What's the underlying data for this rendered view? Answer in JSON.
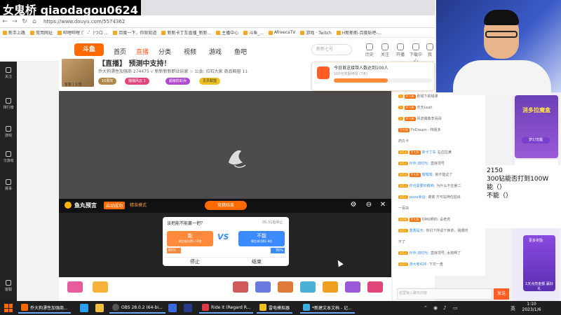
{
  "stream_overlay": {
    "title": "女鬼桥 qiaodagou0624"
  },
  "browser": {
    "url": "https://www.douyu.com/5574362",
    "bookmarks": [
      "新手上路",
      "常用网址",
      "哔哩哔哩 (゜-゜)つロ ...",
      "百度一下，你就知道",
      "新新卡丁车直播_新新...",
      "主播中心",
      "斗鱼_...",
      "AfreecaTV",
      "游戏 · Twitch",
      "H新新新-百度贴吧-..."
    ]
  },
  "site": {
    "logo": "斗鱼",
    "nav": [
      "首页",
      "直播",
      "分类",
      "视频",
      "游戏",
      "鱼吧"
    ],
    "search_placeholder": "新新七号",
    "header_icons": [
      "历史",
      "关注",
      "开播",
      "下载中心",
      "我"
    ]
  },
  "sidebar": {
    "items": [
      "关注",
      "排行榜",
      "游戏",
      "习游戏",
      "赛事",
      "客服"
    ]
  },
  "room": {
    "title": "【直播】 预测中支持！",
    "meta": "乔大狗漂性加强商  274475    √ 新新新新职业玩家    ☆ 公会: 拉石大家    商品橱窗 11",
    "avatar_caption": "客客 | 公告",
    "tags": [
      "10周年",
      "摆摆风云 1",
      "超级防彩兵",
      "贝贝联盟"
    ]
  },
  "prediction": {
    "title": "鱼丸预言",
    "status": "启动成功",
    "mode": "精准模式",
    "button": "竞猜结束",
    "question": "该把能不能赢一把？",
    "timer": "05:31后停止",
    "option_a": {
      "label": "能",
      "sub": "预言成功得1.53倍"
    },
    "option_b": {
      "label": "不能",
      "sub": "预言成功得2.8倍"
    },
    "vs": "VS",
    "pct_a": "65%",
    "pct_b": "35%",
    "btn_stop": "停止",
    "btn_settle": "结束"
  },
  "notification": {
    "title": "今日首送接带人数达到100人",
    "sub": "100元奖励待领 (7天)",
    "progress": 0.55
  },
  "chat": {
    "rows": [
      {
        "level": "1",
        "fan": "乔大狗",
        "name": "",
        "text": "别钱下的钱课"
      },
      {
        "level": "2",
        "fan": "乔大狗",
        "name": "",
        "text": "天天Leah"
      },
      {
        "level": "3",
        "fan": "乔大狗",
        "name": "",
        "text": "风流偶像李哥哥"
      },
      {
        "level": "",
        "fan": "乔大狗",
        "name": "",
        "text": "FoDream - 特姐多"
      },
      {
        "level": "",
        "fan": "",
        "name": "",
        "text": "药丸卡"
      },
      {
        "level": "LV12",
        "fan": "乔大狗",
        "name": "新卡丁车",
        "text": "右边拉满"
      },
      {
        "level": "LV12",
        "fan": "",
        "name": "伙伴.旧时光:",
        "text": "直接顶号"
      },
      {
        "level": "LV16",
        "fan": "乔大狗",
        "name": "嘿嘿嘿:",
        "text": "我不能这了"
      },
      {
        "level": "LV13",
        "fan": "",
        "name": "你也需要好眼呐:",
        "text": "为什么不在第二"
      },
      {
        "level": "LV15",
        "fan": "",
        "name": "pizza幸运:",
        "text": "谢谢 方可站神任拍出"
      },
      {
        "level": "",
        "fan": "",
        "name": "",
        "text": "一百块"
      },
      {
        "level": "LV28",
        "fan": "乔大狗",
        "name": "",
        "text": "OMG啊你: 设老虎"
      },
      {
        "level": "LV21",
        "fan": "",
        "name": "香香是无:",
        "text": "你们下所说下换单，我顺时"
      },
      {
        "level": "",
        "fan": "",
        "name": "",
        "text": "不了"
      },
      {
        "level": "LV12",
        "fan": "",
        "name": "伙伴.旧时光:",
        "text": "直接顶号, 太狗啊了"
      },
      {
        "level": "LV23",
        "fan": "",
        "name": "游大者426:",
        "text": "下次一盘"
      }
    ],
    "input_placeholder": "这里输入聊天内容",
    "send": "发送"
  },
  "ads": {
    "top_title": "消多拉魔盒",
    "top_button": "梦幻觉醒",
    "mid": "点亮新鲜 赢好礼",
    "bottom_top": "更多奖励",
    "bottom_label": "1天点亮金额 赢好礼"
  },
  "overlay_text": {
    "lines": [
      "2150",
      "300钻能否打到100W",
      "能（）",
      "不能（）"
    ]
  },
  "taskbar": {
    "items": [
      "乔大狗漂性加强商...",
      "OBS 28.0.2 (64-bi...",
      "Ride It (Regard R...",
      "雷电模拟器",
      "*新建文本文档 - 记..."
    ],
    "tray": "英",
    "time": "1:10",
    "date": "2023/1/6"
  },
  "colors": {
    "brand": "#ff5d23",
    "accent_blue": "#3c8aff",
    "accent_orange": "#ff8a3c"
  }
}
